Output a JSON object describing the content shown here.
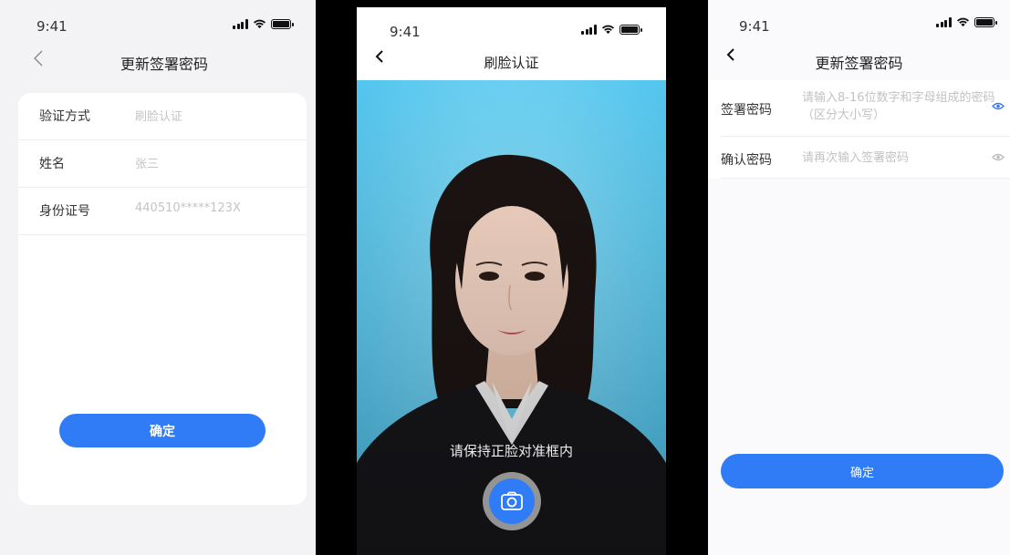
{
  "screen1": {
    "status_time": "9:41",
    "nav_title": "更新签署密码",
    "fields": [
      {
        "label": "验证方式",
        "value": "刷脸认证"
      },
      {
        "label": "姓名",
        "value": "张三"
      },
      {
        "label": "身份证号",
        "value": "440510*****123X"
      }
    ],
    "confirm_label": "确定"
  },
  "screen2": {
    "status_time": "9:41",
    "nav_title": "刷脸认证",
    "hint": "请保持正脸对准框内"
  },
  "screen3": {
    "status_time": "9:41",
    "nav_title": "更新签署密码",
    "fields": [
      {
        "label": "签署密码",
        "placeholder": "请输入8-16位数字和字母组成的密码（区分大小写）"
      },
      {
        "label": "确认密码",
        "placeholder": "请再次输入签署密码"
      }
    ],
    "confirm_label": "确定"
  },
  "icons": {
    "back": "chevron-left-icon",
    "signal": "signal-icon",
    "wifi": "wifi-icon",
    "battery": "battery-icon",
    "eye": "eye-icon",
    "camera": "camera-icon"
  },
  "colors": {
    "accent": "#2f7cf6",
    "camera_bg": "#66d2f4"
  }
}
